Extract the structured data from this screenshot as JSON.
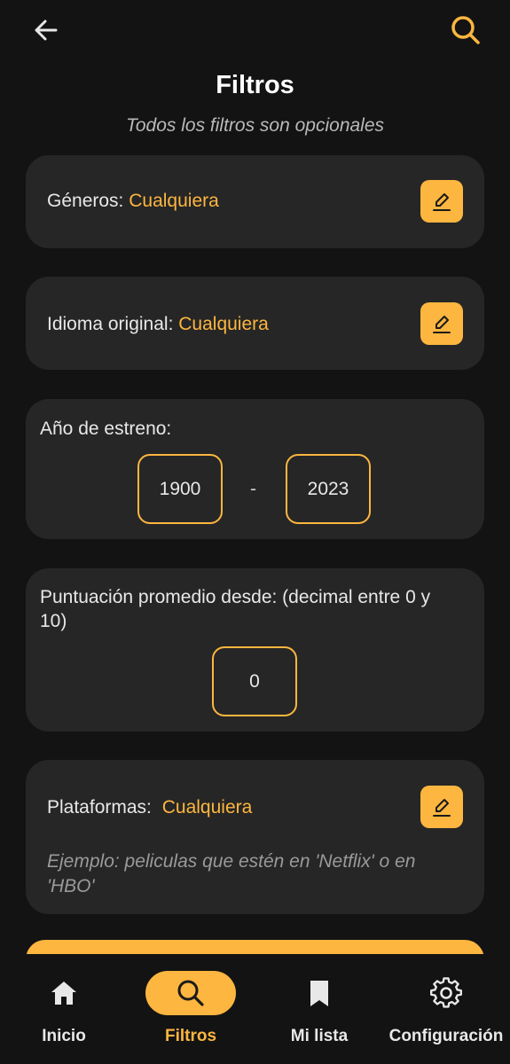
{
  "header": {
    "back_icon": "arrow-left-icon",
    "search_icon": "search-icon",
    "title": "Filtros",
    "subtitle": "Todos los filtros son opcionales"
  },
  "colors": {
    "accent": "#fdb63f",
    "background": "#131313",
    "card": "#262626"
  },
  "filters": {
    "genres": {
      "label": "Géneros:",
      "value": "Cualquiera",
      "edit_icon": "pencil-icon"
    },
    "language": {
      "label": "Idioma original:",
      "value": "Cualquiera",
      "edit_icon": "pencil-icon"
    },
    "year": {
      "label": "Año de estreno:",
      "from": "1900",
      "separator": "-",
      "to": "2023"
    },
    "rating": {
      "label": "Puntuación promedio desde: (decimal entre 0 y 10)",
      "value": "0"
    },
    "platforms": {
      "label": "Plataformas:",
      "value": "Cualquiera",
      "edit_icon": "pencil-icon",
      "example": "Ejemplo: peliculas que estén en 'Netflix' o en 'HBO'"
    }
  },
  "bottom_nav": [
    {
      "label": "Inicio",
      "icon": "home-icon",
      "active": false
    },
    {
      "label": "Filtros",
      "icon": "search-icon",
      "active": true
    },
    {
      "label": "Mi lista",
      "icon": "bookmark-icon",
      "active": false
    },
    {
      "label": "Configuración",
      "icon": "gear-icon",
      "active": false
    }
  ]
}
